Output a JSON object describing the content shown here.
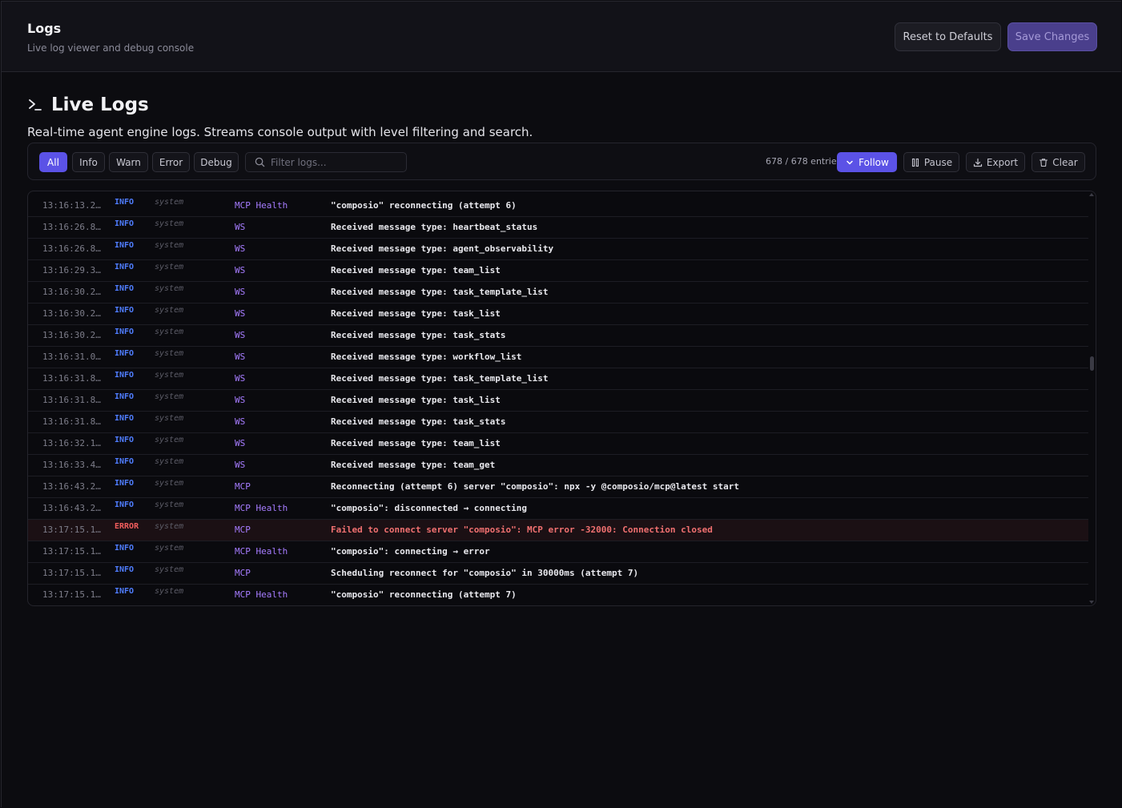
{
  "header": {
    "title": "Logs",
    "subtitle": "Live log viewer and debug console",
    "reset_label": "Reset to Defaults",
    "save_label": "Save Changes"
  },
  "section": {
    "title": "Live Logs",
    "description": "Real-time agent engine logs. Streams console output with level filtering and search."
  },
  "filters": {
    "levels": [
      "All",
      "Info",
      "Warn",
      "Error",
      "Debug"
    ],
    "active": "All",
    "search_placeholder": "Filter logs..."
  },
  "toolbar": {
    "entries": "678 / 678 entries",
    "follow_label": "Follow",
    "pause_label": "Pause",
    "export_label": "Export",
    "clear_label": "Clear"
  },
  "colors": {
    "accent": "#5b52e6",
    "info": "#4f7dff",
    "error": "#f15d5d",
    "component": "#a67cff"
  },
  "logs": [
    {
      "time": "13:16:13.2…",
      "level": "INFO",
      "source": "system",
      "component": "MCP Health",
      "message": "\"composio\" reconnecting (attempt 6)"
    },
    {
      "time": "13:16:26.8…",
      "level": "INFO",
      "source": "system",
      "component": "WS",
      "message": "Received message type: heartbeat_status"
    },
    {
      "time": "13:16:26.8…",
      "level": "INFO",
      "source": "system",
      "component": "WS",
      "message": "Received message type: agent_observability"
    },
    {
      "time": "13:16:29.3…",
      "level": "INFO",
      "source": "system",
      "component": "WS",
      "message": "Received message type: team_list"
    },
    {
      "time": "13:16:30.2…",
      "level": "INFO",
      "source": "system",
      "component": "WS",
      "message": "Received message type: task_template_list"
    },
    {
      "time": "13:16:30.2…",
      "level": "INFO",
      "source": "system",
      "component": "WS",
      "message": "Received message type: task_list"
    },
    {
      "time": "13:16:30.2…",
      "level": "INFO",
      "source": "system",
      "component": "WS",
      "message": "Received message type: task_stats"
    },
    {
      "time": "13:16:31.0…",
      "level": "INFO",
      "source": "system",
      "component": "WS",
      "message": "Received message type: workflow_list"
    },
    {
      "time": "13:16:31.8…",
      "level": "INFO",
      "source": "system",
      "component": "WS",
      "message": "Received message type: task_template_list"
    },
    {
      "time": "13:16:31.8…",
      "level": "INFO",
      "source": "system",
      "component": "WS",
      "message": "Received message type: task_list"
    },
    {
      "time": "13:16:31.8…",
      "level": "INFO",
      "source": "system",
      "component": "WS",
      "message": "Received message type: task_stats"
    },
    {
      "time": "13:16:32.1…",
      "level": "INFO",
      "source": "system",
      "component": "WS",
      "message": "Received message type: team_list"
    },
    {
      "time": "13:16:33.4…",
      "level": "INFO",
      "source": "system",
      "component": "WS",
      "message": "Received message type: team_get"
    },
    {
      "time": "13:16:43.2…",
      "level": "INFO",
      "source": "system",
      "component": "MCP",
      "message": "Reconnecting (attempt 6) server \"composio\": npx -y @composio/mcp@latest start"
    },
    {
      "time": "13:16:43.2…",
      "level": "INFO",
      "source": "system",
      "component": "MCP Health",
      "message": "\"composio\": disconnected → connecting"
    },
    {
      "time": "13:17:15.1…",
      "level": "ERROR",
      "source": "system",
      "component": "MCP",
      "message": "Failed to connect server \"composio\": MCP error -32000: Connection closed"
    },
    {
      "time": "13:17:15.1…",
      "level": "INFO",
      "source": "system",
      "component": "MCP Health",
      "message": "\"composio\": connecting → error"
    },
    {
      "time": "13:17:15.1…",
      "level": "INFO",
      "source": "system",
      "component": "MCP",
      "message": "Scheduling reconnect for \"composio\" in 30000ms (attempt 7)"
    },
    {
      "time": "13:17:15.1…",
      "level": "INFO",
      "source": "system",
      "component": "MCP Health",
      "message": "\"composio\" reconnecting (attempt 7)"
    }
  ]
}
